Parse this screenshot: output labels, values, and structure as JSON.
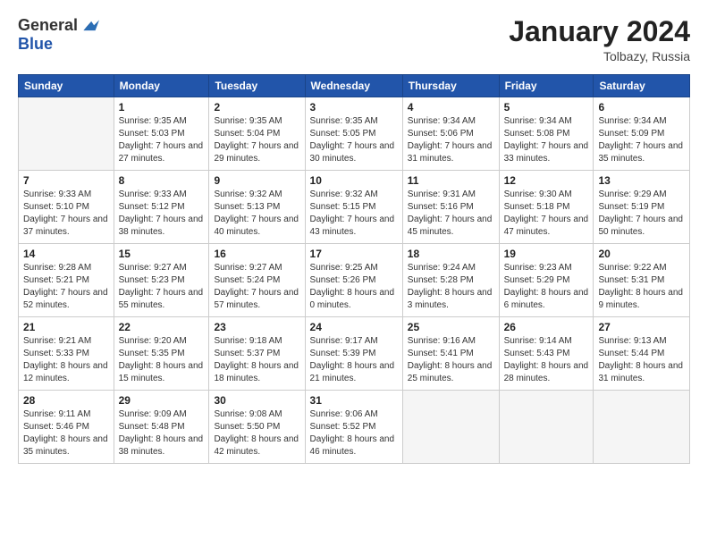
{
  "logo": {
    "general": "General",
    "blue": "Blue"
  },
  "title": "January 2024",
  "location": "Tolbazy, Russia",
  "days_of_week": [
    "Sunday",
    "Monday",
    "Tuesday",
    "Wednesday",
    "Thursday",
    "Friday",
    "Saturday"
  ],
  "weeks": [
    [
      {
        "day": "",
        "sunrise": "",
        "sunset": "",
        "daylight": ""
      },
      {
        "day": "1",
        "sunrise": "9:35 AM",
        "sunset": "5:03 PM",
        "daylight": "7 hours and 27 minutes."
      },
      {
        "day": "2",
        "sunrise": "9:35 AM",
        "sunset": "5:04 PM",
        "daylight": "7 hours and 29 minutes."
      },
      {
        "day": "3",
        "sunrise": "9:35 AM",
        "sunset": "5:05 PM",
        "daylight": "7 hours and 30 minutes."
      },
      {
        "day": "4",
        "sunrise": "9:34 AM",
        "sunset": "5:06 PM",
        "daylight": "7 hours and 31 minutes."
      },
      {
        "day": "5",
        "sunrise": "9:34 AM",
        "sunset": "5:08 PM",
        "daylight": "7 hours and 33 minutes."
      },
      {
        "day": "6",
        "sunrise": "9:34 AM",
        "sunset": "5:09 PM",
        "daylight": "7 hours and 35 minutes."
      }
    ],
    [
      {
        "day": "7",
        "sunrise": "9:33 AM",
        "sunset": "5:10 PM",
        "daylight": "7 hours and 37 minutes."
      },
      {
        "day": "8",
        "sunrise": "9:33 AM",
        "sunset": "5:12 PM",
        "daylight": "7 hours and 38 minutes."
      },
      {
        "day": "9",
        "sunrise": "9:32 AM",
        "sunset": "5:13 PM",
        "daylight": "7 hours and 40 minutes."
      },
      {
        "day": "10",
        "sunrise": "9:32 AM",
        "sunset": "5:15 PM",
        "daylight": "7 hours and 43 minutes."
      },
      {
        "day": "11",
        "sunrise": "9:31 AM",
        "sunset": "5:16 PM",
        "daylight": "7 hours and 45 minutes."
      },
      {
        "day": "12",
        "sunrise": "9:30 AM",
        "sunset": "5:18 PM",
        "daylight": "7 hours and 47 minutes."
      },
      {
        "day": "13",
        "sunrise": "9:29 AM",
        "sunset": "5:19 PM",
        "daylight": "7 hours and 50 minutes."
      }
    ],
    [
      {
        "day": "14",
        "sunrise": "9:28 AM",
        "sunset": "5:21 PM",
        "daylight": "7 hours and 52 minutes."
      },
      {
        "day": "15",
        "sunrise": "9:27 AM",
        "sunset": "5:23 PM",
        "daylight": "7 hours and 55 minutes."
      },
      {
        "day": "16",
        "sunrise": "9:27 AM",
        "sunset": "5:24 PM",
        "daylight": "7 hours and 57 minutes."
      },
      {
        "day": "17",
        "sunrise": "9:25 AM",
        "sunset": "5:26 PM",
        "daylight": "8 hours and 0 minutes."
      },
      {
        "day": "18",
        "sunrise": "9:24 AM",
        "sunset": "5:28 PM",
        "daylight": "8 hours and 3 minutes."
      },
      {
        "day": "19",
        "sunrise": "9:23 AM",
        "sunset": "5:29 PM",
        "daylight": "8 hours and 6 minutes."
      },
      {
        "day": "20",
        "sunrise": "9:22 AM",
        "sunset": "5:31 PM",
        "daylight": "8 hours and 9 minutes."
      }
    ],
    [
      {
        "day": "21",
        "sunrise": "9:21 AM",
        "sunset": "5:33 PM",
        "daylight": "8 hours and 12 minutes."
      },
      {
        "day": "22",
        "sunrise": "9:20 AM",
        "sunset": "5:35 PM",
        "daylight": "8 hours and 15 minutes."
      },
      {
        "day": "23",
        "sunrise": "9:18 AM",
        "sunset": "5:37 PM",
        "daylight": "8 hours and 18 minutes."
      },
      {
        "day": "24",
        "sunrise": "9:17 AM",
        "sunset": "5:39 PM",
        "daylight": "8 hours and 21 minutes."
      },
      {
        "day": "25",
        "sunrise": "9:16 AM",
        "sunset": "5:41 PM",
        "daylight": "8 hours and 25 minutes."
      },
      {
        "day": "26",
        "sunrise": "9:14 AM",
        "sunset": "5:43 PM",
        "daylight": "8 hours and 28 minutes."
      },
      {
        "day": "27",
        "sunrise": "9:13 AM",
        "sunset": "5:44 PM",
        "daylight": "8 hours and 31 minutes."
      }
    ],
    [
      {
        "day": "28",
        "sunrise": "9:11 AM",
        "sunset": "5:46 PM",
        "daylight": "8 hours and 35 minutes."
      },
      {
        "day": "29",
        "sunrise": "9:09 AM",
        "sunset": "5:48 PM",
        "daylight": "8 hours and 38 minutes."
      },
      {
        "day": "30",
        "sunrise": "9:08 AM",
        "sunset": "5:50 PM",
        "daylight": "8 hours and 42 minutes."
      },
      {
        "day": "31",
        "sunrise": "9:06 AM",
        "sunset": "5:52 PM",
        "daylight": "8 hours and 46 minutes."
      },
      {
        "day": "",
        "sunrise": "",
        "sunset": "",
        "daylight": ""
      },
      {
        "day": "",
        "sunrise": "",
        "sunset": "",
        "daylight": ""
      },
      {
        "day": "",
        "sunrise": "",
        "sunset": "",
        "daylight": ""
      }
    ]
  ]
}
